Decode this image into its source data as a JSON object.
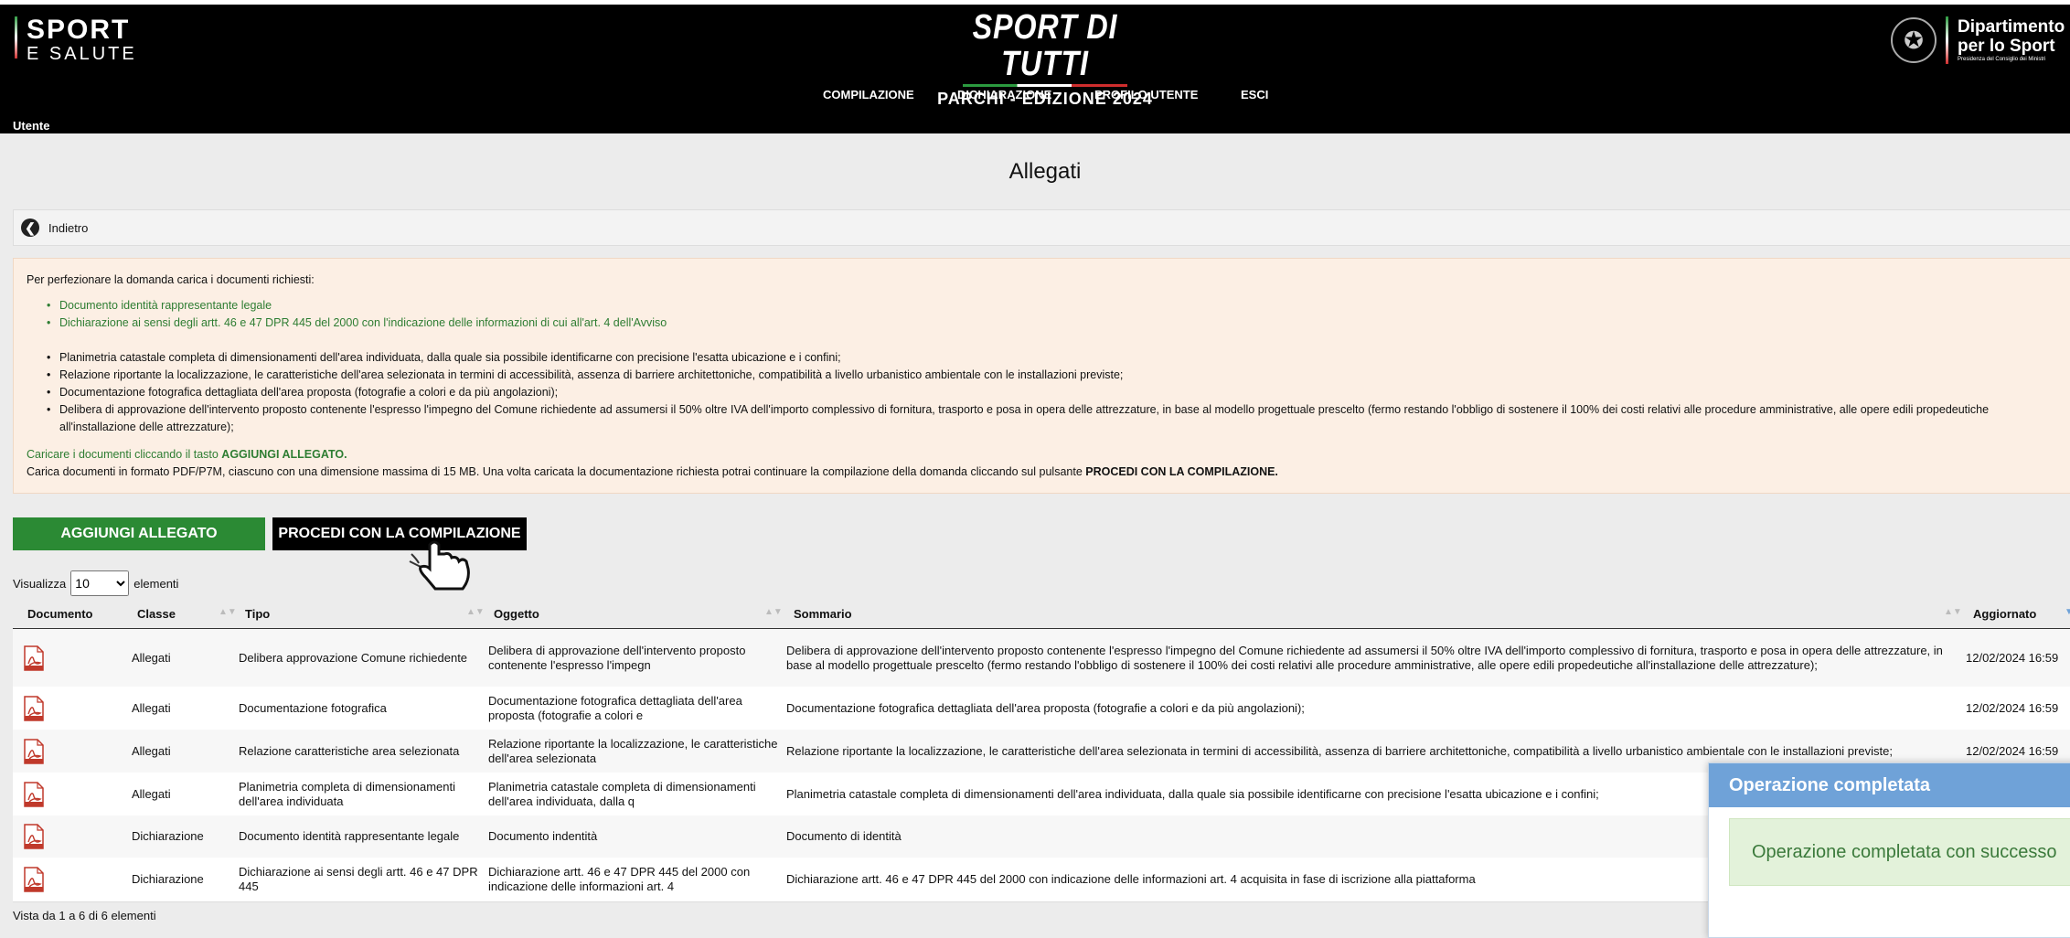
{
  "header": {
    "logo_left_line1": "SPORT",
    "logo_left_line2": "E SALUTE",
    "brand_title": "SPORT DI TUTTI",
    "brand_subtitle": "PARCHI - EDIZIONE 2024",
    "gov_line1": "Dipartimento",
    "gov_line2": "per lo Sport",
    "gov_line3": "Presidenza del Consiglio dei Ministri",
    "user_label": "Utente",
    "nav": [
      "COMPILAZIONE",
      "DICHIARAZIONE",
      "PROFILO UTENTE",
      "ESCI"
    ]
  },
  "page": {
    "title": "Allegati",
    "back_label": "Indietro"
  },
  "info": {
    "intro": "Per perfezionare la domanda carica i documenti richiesti:",
    "required_docs": [
      "Documento identità rappresentante legale",
      "Dichiarazione ai sensi degli artt. 46 e 47 DPR 445 del 2000 con l'indicazione delle informazioni di cui all'art. 4 dell'Avviso"
    ],
    "other_docs": [
      "Planimetria catastale completa di dimensionamenti dell'area individuata, dalla quale sia possibile identificarne con precisione l'esatta ubicazione e i confini;",
      "Relazione riportante la localizzazione, le caratteristiche dell'area selezionata in termini di accessibilità, assenza di barriere architettoniche, compatibilità a livello urbanistico ambientale con le installazioni previste;",
      "Documentazione fotografica dettagliata dell'area proposta (fotografie a colori e da più angolazioni);",
      "Delibera di approvazione dell'intervento proposto contenente l'espresso l'impegno del Comune richiedente ad assumersi il 50% oltre IVA dell'importo complessivo di fornitura, trasporto e posa in opera delle attrezzature, in base al modello progettuale prescelto (fermo restando l'obbligo di sostenere il 100% dei costi relativi alle procedure amministrative, alle opere edili propedeutiche all'installazione delle attrezzature);"
    ],
    "upload_prefix": "Caricare i documenti cliccando il tasto ",
    "upload_button_ref": "AGGIUNGI ALLEGATO.",
    "format_text": "Carica documenti in formato PDF/P7M, ciascuno con una dimensione massima di 15 MB. Una volta caricata la documentazione richiesta potrai continuare la compilazione della domanda cliccando sul pulsante ",
    "format_button_ref": "PROCEDI CON LA COMPILAZIONE."
  },
  "actions": {
    "add_label": "AGGIUNGI ALLEGATO",
    "proceed_label": "PROCEDI CON LA COMPILAZIONE"
  },
  "table": {
    "length_prefix": "Visualizza",
    "length_value": "10",
    "length_suffix": "elementi",
    "columns": [
      "Documento",
      "Classe",
      "Tipo",
      "Oggetto",
      "Sommario",
      "Aggiornato"
    ],
    "rows": [
      {
        "classe": "Allegati",
        "tipo": "Delibera approvazione Comune richiedente",
        "oggetto": "Delibera di approvazione dell'intervento proposto contenente l'espresso l'impegn",
        "sommario": "Delibera di approvazione dell'intervento proposto contenente l'espresso l'impegno del Comune richiedente ad assumersi il 50% oltre IVA dell'importo complessivo di fornitura, trasporto e posa in opera delle attrezzature, in base al modello progettuale prescelto (fermo restando l'obbligo di sostenere il 100% dei costi relativi alle procedure amministrative, alle opere edili propedeutiche all'installazione delle attrezzature);",
        "aggiornato": "12/02/2024 16:59"
      },
      {
        "classe": "Allegati",
        "tipo": "Documentazione fotografica",
        "oggetto": "Documentazione fotografica dettagliata dell'area proposta (fotografie a colori e",
        "sommario": "Documentazione fotografica dettagliata dell'area proposta (fotografie a colori e da più angolazioni);",
        "aggiornato": "12/02/2024 16:59"
      },
      {
        "classe": "Allegati",
        "tipo": "Relazione caratteristiche area selezionata",
        "oggetto": "Relazione riportante la localizzazione, le caratteristiche dell'area selezionata",
        "sommario": "Relazione riportante la localizzazione, le caratteristiche dell'area selezionata in termini di accessibilità, assenza di barriere architettoniche, compatibilità a livello urbanistico ambientale con le installazioni previste;",
        "aggiornato": "12/02/2024 16:59"
      },
      {
        "classe": "Allegati",
        "tipo": "Planimetria completa di dimensionamenti dell'area individuata",
        "oggetto": "Planimetria catastale completa di dimensionamenti dell'area individuata, dalla q",
        "sommario": "Planimetria catastale completa di dimensionamenti dell'area individuata, dalla quale sia possibile identificarne con precisione l'esatta ubicazione e i confini;",
        "aggiornato": ""
      },
      {
        "classe": "Dichiarazione",
        "tipo": "Documento identità rappresentante legale",
        "oggetto": "Documento indentità",
        "sommario": "Documento di identità",
        "aggiornato": ""
      },
      {
        "classe": "Dichiarazione",
        "tipo": "Dichiarazione ai sensi degli artt. 46 e 47 DPR 445",
        "oggetto": "Dichiarazione artt. 46 e 47 DPR 445 del 2000 con indicazione delle informazioni art. 4",
        "sommario": "Dichiarazione artt. 46 e 47 DPR 445 del 2000 con indicazione delle informazioni art. 4 acquisita in fase di iscrizione alla piattaforma",
        "aggiornato": ""
      }
    ],
    "info": "Vista da 1 a 6 di 6 elementi"
  },
  "toast": {
    "title": "Operazione completata",
    "message": "Operazione completata con successo"
  },
  "colors": {
    "header_bg": "#000000",
    "add_button": "#2b8a34",
    "info_bg": "#fcefe4",
    "toast_header": "#6fa2d8",
    "toast_body": "#e3f2da"
  },
  "icons": [
    "back-arrow-icon",
    "pdf-file-icon",
    "hand-pointer-icon",
    "italian-emblem-icon"
  ]
}
